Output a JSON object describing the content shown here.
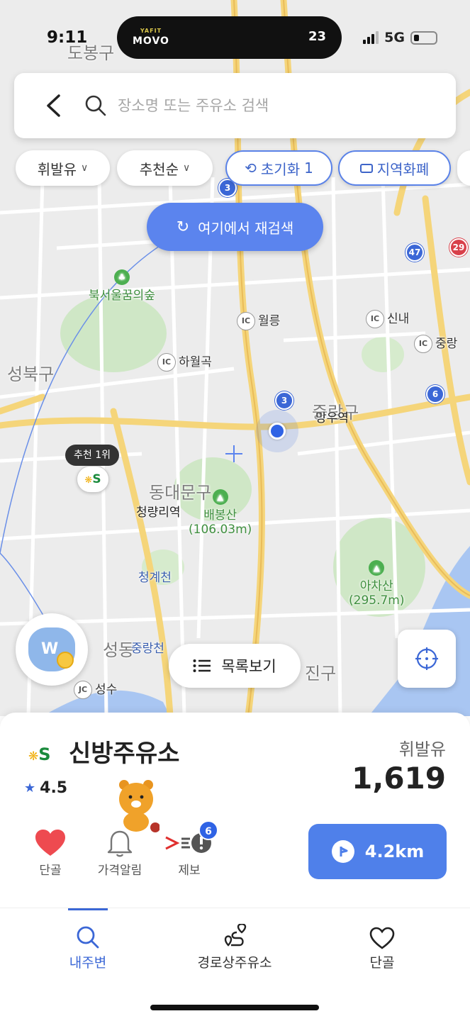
{
  "status_bar": {
    "time": "9:11",
    "island_brand_top": "YAFIT",
    "island_brand": "MOVO",
    "island_number": "23",
    "network": "5G"
  },
  "search": {
    "placeholder": "장소명 또는 주유소 검색"
  },
  "filters": {
    "fuel": "휘발유",
    "sort": "추천순",
    "reset": "초기화",
    "reset_count": "1",
    "local_currency": "지역화폐"
  },
  "research_label": "여기에서 재검색",
  "map": {
    "areas": [
      "도봉구",
      "성북구",
      "동대문구",
      "중랑구",
      "광진구"
    ],
    "places": {
      "bukseoul": "북서울꿈의숲",
      "wolleung": "월릉",
      "sinnae": "신내",
      "junghwa": "중랑",
      "hawolgok": "하월곡",
      "mangu": "망우역",
      "cheongnyangni": "청량리역",
      "baebongsan": "배봉산",
      "baebongsan_height": "(106.03m)",
      "cheonggyecheon": "청계천",
      "achasan": "아차산",
      "achasan_height": "(295.7m)",
      "seongdong": "성동",
      "jungnangcheon": "중랑천",
      "seongsu": "성수",
      "gwangjin_partial": "진구"
    },
    "ic_label": "IC",
    "jc_label": "JC",
    "route_numbers": [
      "3",
      "3",
      "47",
      "6",
      "29"
    ],
    "recommend_tag": "추천 1위"
  },
  "list_view_label": "목록보기",
  "station": {
    "name": "신방주유소",
    "rating": "4.5",
    "fuel_type": "휘발유",
    "price": "1,619",
    "actions": {
      "favorite": "단골",
      "price_alert": "가격알림",
      "report": "제보"
    },
    "report_badge": "6",
    "distance": "4.2km"
  },
  "tabs": {
    "nearby": "내주변",
    "route": "경로상주유소",
    "favorites": "단골"
  },
  "colors": {
    "accent": "#4f80ea",
    "brand_green": "#1a8a3c",
    "brand_yellow": "#f0b010"
  }
}
